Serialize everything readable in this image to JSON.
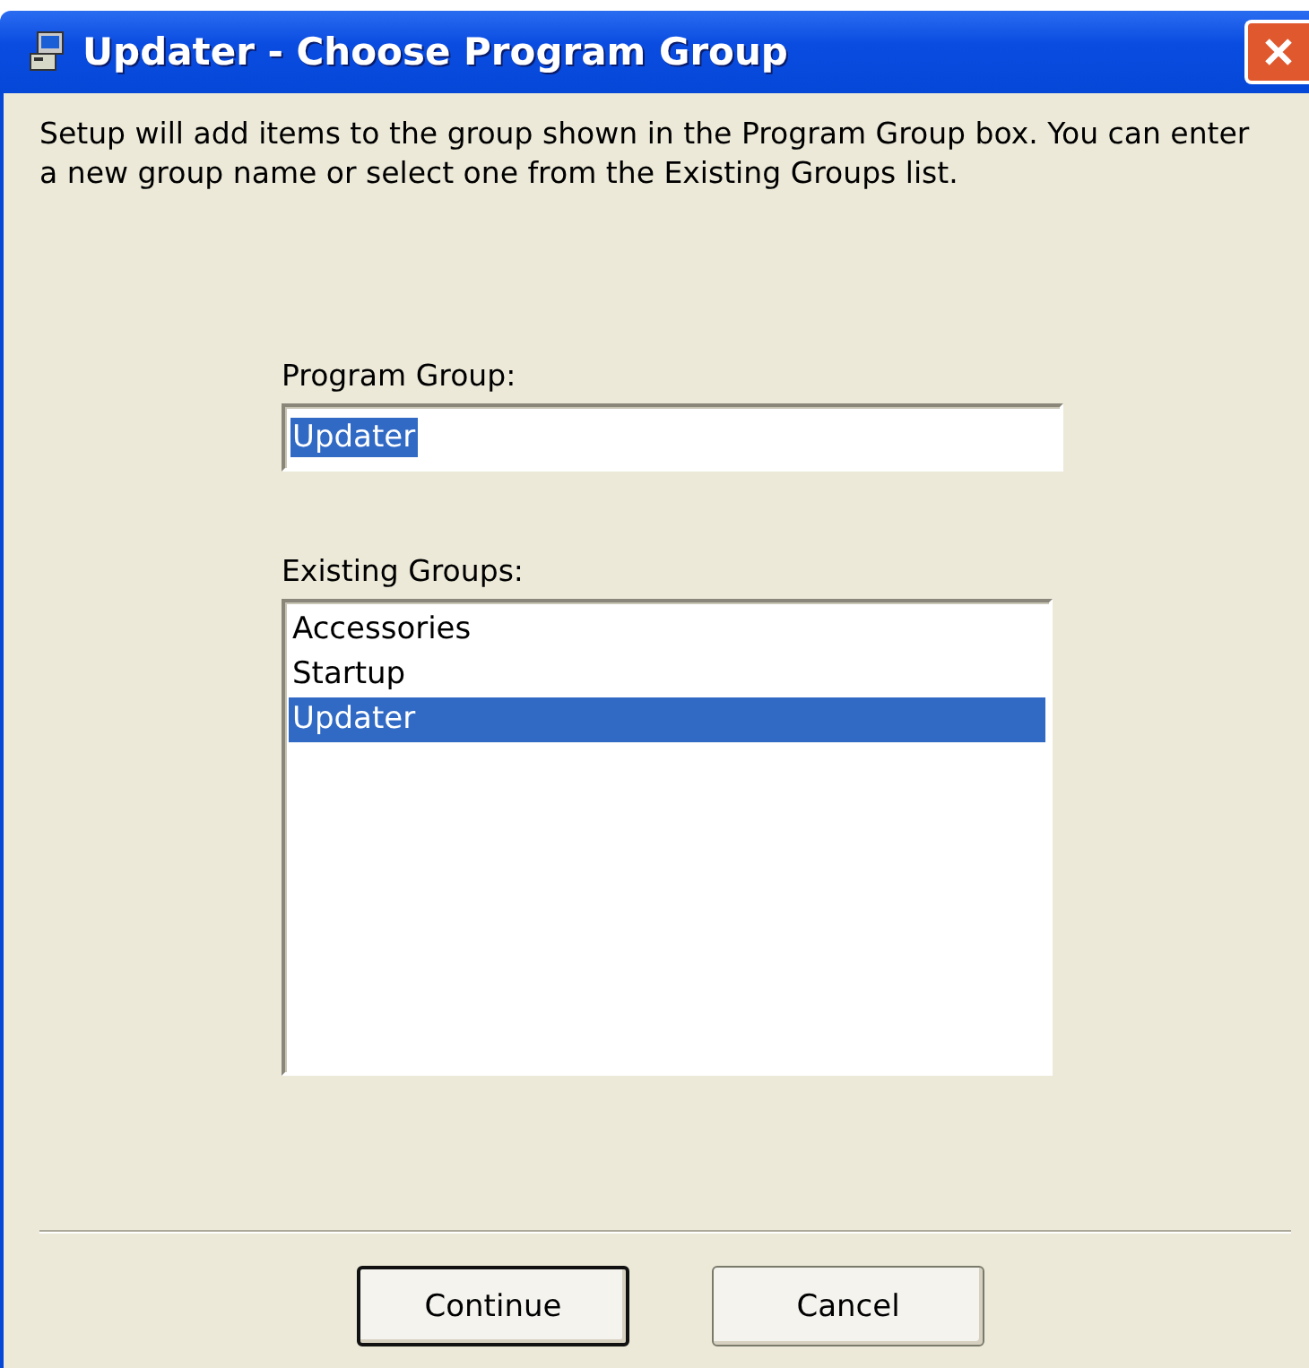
{
  "window": {
    "title": "Updater - Choose Program Group"
  },
  "instructions": "Setup will add items to the group shown in the Program Group box. You can enter a new group name or select one from the Existing Groups list.",
  "program_group": {
    "label": "Program Group:",
    "value": "Updater",
    "text_selected": true
  },
  "existing_groups": {
    "label": "Existing Groups:",
    "items": [
      {
        "label": "Accessories",
        "selected": false
      },
      {
        "label": "Startup",
        "selected": false
      },
      {
        "label": "Updater",
        "selected": true
      }
    ]
  },
  "buttons": [
    {
      "label": "Continue",
      "default": true
    },
    {
      "label": "Cancel",
      "default": false
    }
  ]
}
